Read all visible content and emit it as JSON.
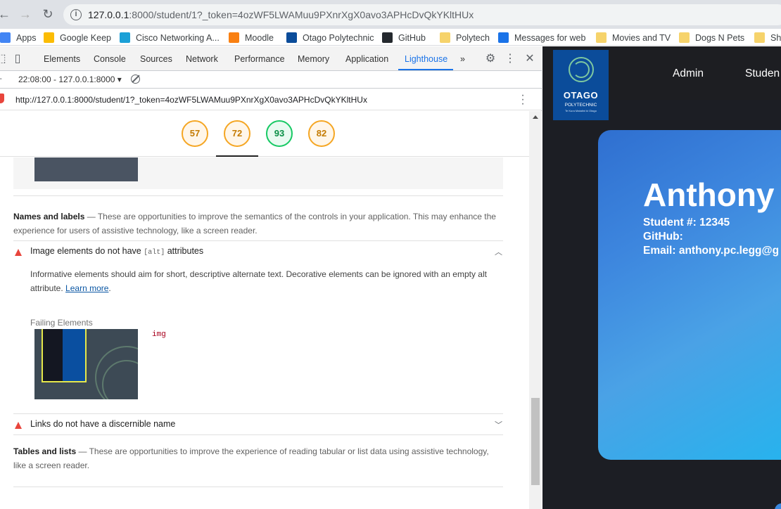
{
  "browser": {
    "url_host": "127.0.0.1",
    "url_rest": ":8000/student/1?_token=4ozWF5LWAMuu9PXnrXgX0avo3APHcDvQkYKltHUx",
    "bookmarks": [
      {
        "label": "Apps",
        "color": "#4285f4"
      },
      {
        "label": "Google Keep",
        "color": "#fbbc04"
      },
      {
        "label": "Cisco Networking A...",
        "color": "#1ba0d7"
      },
      {
        "label": "Moodle",
        "color": "#f98012"
      },
      {
        "label": "Otago Polytechnic",
        "color": "#0b4c9a"
      },
      {
        "label": "GitHub",
        "color": "#24292e"
      },
      {
        "label": "Polytech",
        "color": "#f6d36b"
      },
      {
        "label": "Messages for web",
        "color": "#1a73e8"
      },
      {
        "label": "Movies and TV",
        "color": "#f6d36b"
      },
      {
        "label": "Dogs N Pets",
        "color": "#f6d36b"
      },
      {
        "label": "Sho",
        "color": "#f6d36b"
      }
    ]
  },
  "devtools": {
    "tabs": [
      "Elements",
      "Console",
      "Sources",
      "Network",
      "Performance",
      "Memory",
      "Application",
      "Lighthouse"
    ],
    "active_tab": "Lighthouse",
    "more_tabs": "»",
    "report_selector": "22:08:00 - 127.0.0.1:8000",
    "report_url": "http://127.0.0.1:8000/student/1?_token=4ozWF5LWAMuu9PXnrXgX0avo3APHcDvQkYKltHUx"
  },
  "lighthouse": {
    "scores": [
      57,
      72,
      93,
      82
    ],
    "names_group_title": "Names and labels",
    "names_group_desc": "— These are opportunities to improve the semantics of the controls in your application. This may enhance the experience for users of assistive technology, like a screen reader.",
    "audit1_pre": "Image elements do not have ",
    "audit1_code": "[alt]",
    "audit1_post": " attributes",
    "audit1_desc": "Informative elements should aim for short, descriptive alternate text. Decorative elements can be ignored with an empty alt attribute.",
    "learn_more": "Learn more",
    "audit1_desc_end": ".",
    "failing_label": "Failing Elements",
    "failing_node": "img",
    "audit2_title": "Links do not have a discernible name",
    "tables_group_title": "Tables and lists",
    "tables_group_desc": "— These are opportunities to improve the experience of reading tabular or list data using assistive technology, like a screen reader."
  },
  "site": {
    "logo_name": "OTAGO",
    "logo_sub": "POLYTECHNIC",
    "logo_tiny": "Te Kura Matatini ki Otago",
    "nav": [
      "Admin",
      "Studen"
    ],
    "profile_name": "Anthony",
    "student_no": "Student #: 12345",
    "github": "GitHub:",
    "email": "Email: anthony.pc.legg@g"
  }
}
